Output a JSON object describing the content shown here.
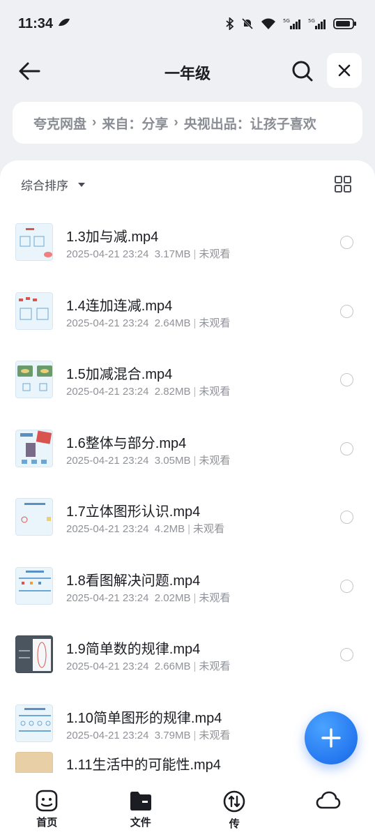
{
  "status_bar": {
    "time": "11:34",
    "network_label": "5G"
  },
  "header": {
    "title": "一年级"
  },
  "breadcrumb": {
    "items": [
      "夸克网盘",
      "来自：分享",
      "央视出品：让孩子喜欢"
    ]
  },
  "toolbar": {
    "sort_label": "综合排序"
  },
  "files": [
    {
      "name": "1.3加与减.mp4",
      "date": "2025-04-21 23:24",
      "size": "3.17MB",
      "status": "未观看"
    },
    {
      "name": "1.4连加连减.mp4",
      "date": "2025-04-21 23:24",
      "size": "2.64MB",
      "status": "未观看"
    },
    {
      "name": "1.5加减混合.mp4",
      "date": "2025-04-21 23:24",
      "size": "2.82MB",
      "status": "未观看"
    },
    {
      "name": "1.6整体与部分.mp4",
      "date": "2025-04-21 23:24",
      "size": "3.05MB",
      "status": "未观看"
    },
    {
      "name": "1.7立体图形认识.mp4",
      "date": "2025-04-21 23:24",
      "size": "4.2MB",
      "status": "未观看"
    },
    {
      "name": "1.8看图解决问题.mp4",
      "date": "2025-04-21 23:24",
      "size": "2.02MB",
      "status": "未观看"
    },
    {
      "name": "1.9简单数的规律.mp4",
      "date": "2025-04-21 23:24",
      "size": "2.66MB",
      "status": "未观看"
    },
    {
      "name": "1.10简单图形的规律.mp4",
      "date": "2025-04-21 23:24",
      "size": "3.79MB",
      "status": "未观看"
    }
  ],
  "partial_file": {
    "name": "1.11生活中的可能性.mp4"
  },
  "bottom_nav": {
    "items": [
      {
        "label": "首页",
        "icon": "home-face-icon"
      },
      {
        "label": "文件",
        "icon": "folder-icon"
      },
      {
        "label": "传",
        "icon": "transfer-icon"
      },
      {
        "label": "",
        "icon": "cloud-icon"
      }
    ]
  },
  "colors": {
    "accent": "#1565e8",
    "background": "#eef0f3"
  }
}
